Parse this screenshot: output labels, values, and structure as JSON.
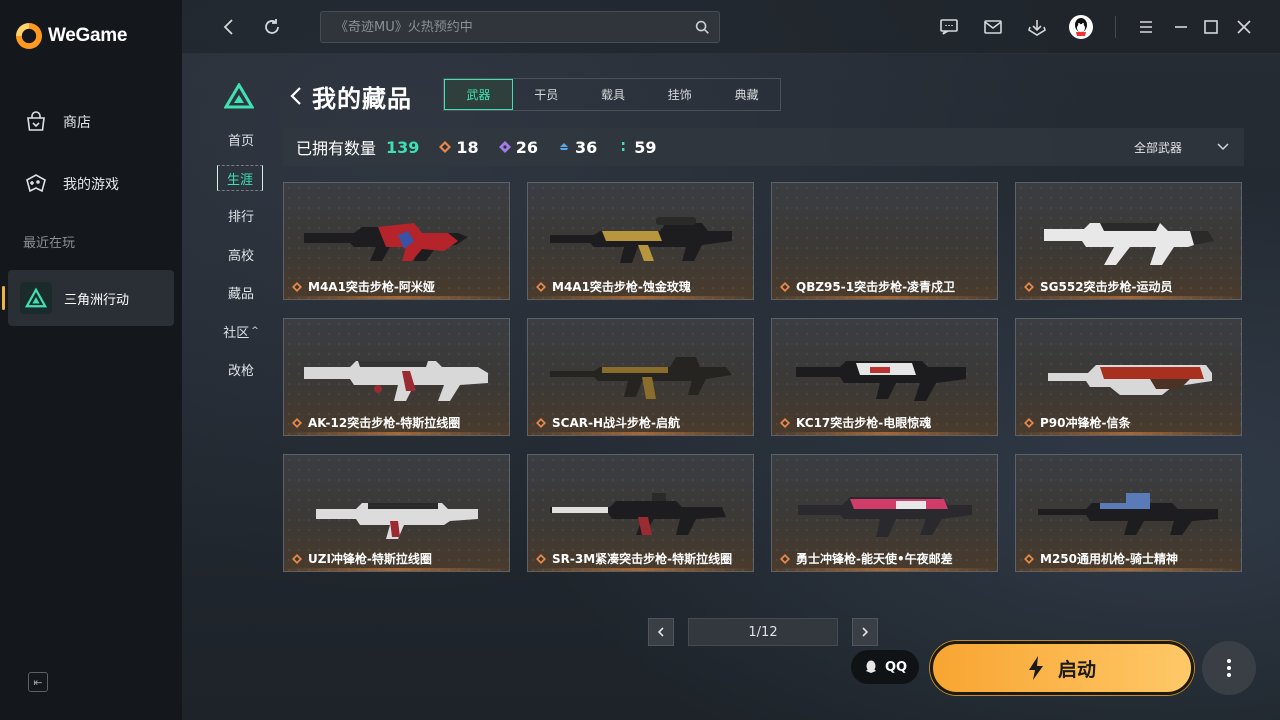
{
  "app": {
    "brand": "WeGame"
  },
  "sidebar": {
    "items": [
      {
        "label": "商店",
        "icon": "shop-bag-icon"
      },
      {
        "label": "我的游戏",
        "icon": "gamepad-icon"
      }
    ],
    "recent_label": "最近在玩",
    "recent_game": {
      "label": "三角洲行动",
      "icon": "delta-force-logo-icon"
    }
  },
  "topbar": {
    "search_placeholder": "《奇迹MU》火热预约中",
    "icons": [
      "back-arrow-icon",
      "refresh-icon",
      "search-icon",
      "chat-icon",
      "mail-icon",
      "download-icon",
      "qq-avatar",
      "menu-icon",
      "minimize-icon",
      "maximize-icon",
      "close-icon"
    ]
  },
  "inner_nav": [
    "首页",
    "生涯",
    "排行",
    "高校",
    "藏品",
    "社区",
    "改枪"
  ],
  "inner_nav_active": "生涯",
  "page": {
    "title": "我的藏品",
    "tabs": [
      "武器",
      "干员",
      "载具",
      "挂饰",
      "典藏"
    ],
    "active_tab": "武器"
  },
  "stats": {
    "owned_label": "已拥有数量",
    "owned_count": "139",
    "tiers": [
      {
        "value": "18",
        "color": "#e8874a",
        "icon": "red-rarity-icon"
      },
      {
        "value": "26",
        "color": "#a07de6",
        "icon": "purple-rarity-icon"
      },
      {
        "value": "36",
        "color": "#5aa6e8",
        "icon": "blue-rarity-icon"
      },
      {
        "value": "59",
        "color": "#3fe0b2",
        "icon": "green-rarity-icon"
      }
    ],
    "filter_label": "全部武器"
  },
  "weapons": [
    {
      "name": "M4A1突击步枪-阿米娅",
      "accent": "#b5242a"
    },
    {
      "name": "M4A1突击步枪-蚀金玫瑰",
      "accent": "#b8963e"
    },
    {
      "name": "QBZ95-1突击步枪-凌青戍卫",
      "accent": ""
    },
    {
      "name": "SG552突击步枪-运动员",
      "accent": "#e8e8e8"
    },
    {
      "name": "AK-12突击步枪-特斯拉线圈",
      "accent": "#d8d8d8"
    },
    {
      "name": "SCAR-H战斗步枪-启航",
      "accent": "#8a6c2c"
    },
    {
      "name": "KC17突击步枪-电眼惊魂",
      "accent": "#e6e6e6"
    },
    {
      "name": "P90冲锋枪-信条",
      "accent": "#a8301e"
    },
    {
      "name": "UZI冲锋枪-特斯拉线圈",
      "accent": "#dcdcdc"
    },
    {
      "name": "SR-3M紧凑突击步枪-特斯拉线圈",
      "accent": "#e0e0e0"
    },
    {
      "name": "勇士冲锋枪-能天使•午夜邮差",
      "accent": "#d23c6a"
    },
    {
      "name": "M250通用机枪-骑士精神",
      "accent": "#5a7bb8"
    }
  ],
  "pagination": {
    "indicator": "1/12"
  },
  "bottom": {
    "qq_label": "QQ",
    "launch_label": "启动"
  }
}
